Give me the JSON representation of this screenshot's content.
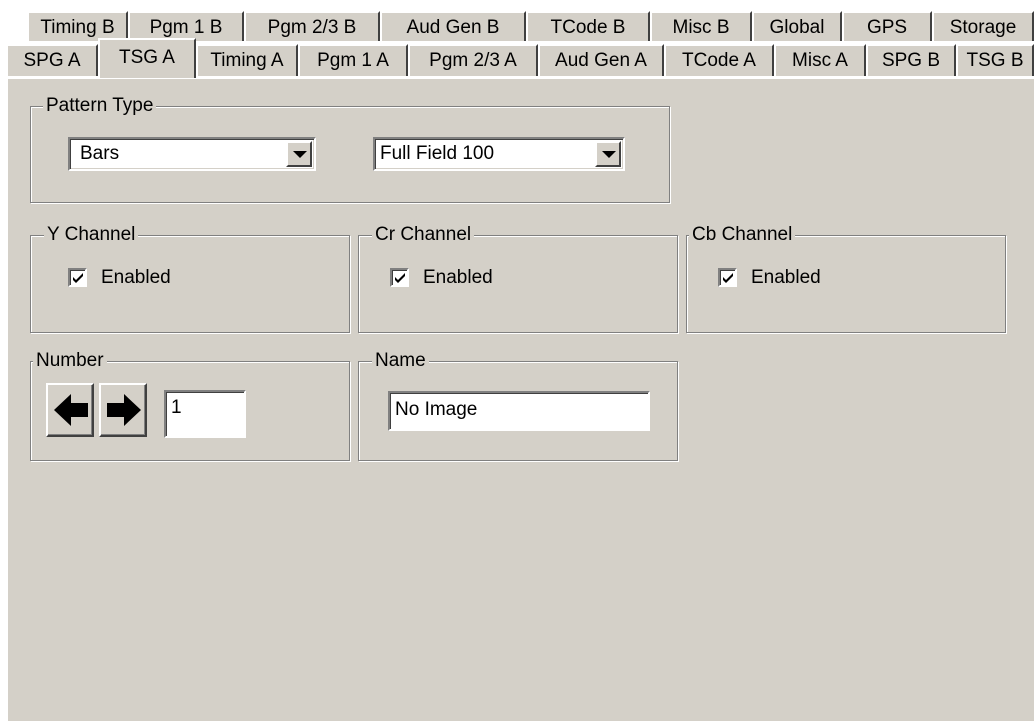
{
  "tabs": {
    "back_row": [
      "Timing B",
      "Pgm 1 B",
      "Pgm 2/3 B",
      "Aud Gen B",
      "TCode B",
      "Misc B",
      "Global",
      "GPS",
      "Storage"
    ],
    "front_row": [
      "SPG A",
      "TSG A",
      "Timing A",
      "Pgm 1 A",
      "Pgm 2/3 A",
      "Aud Gen A",
      "TCode A",
      "Misc A",
      "SPG B",
      "TSG B"
    ],
    "active": "TSG A"
  },
  "pattern_type": {
    "legend": "Pattern Type",
    "pattern": "Bars",
    "variant": "Full Field 100"
  },
  "channels": {
    "y": {
      "legend": "Y Channel",
      "label": "Enabled",
      "checked": true
    },
    "cr": {
      "legend": "Cr Channel",
      "label": "Enabled",
      "checked": true
    },
    "cb": {
      "legend": "Cb Channel",
      "label": "Enabled",
      "checked": true
    }
  },
  "number": {
    "legend": "Number",
    "value": "1",
    "prev_icon": "arrow-left-icon",
    "next_icon": "arrow-right-icon"
  },
  "name": {
    "legend": "Name",
    "value": "No Image"
  },
  "colors": {
    "face": "#d4d0c8",
    "shadow": "#808080",
    "highlight": "#ffffff"
  }
}
